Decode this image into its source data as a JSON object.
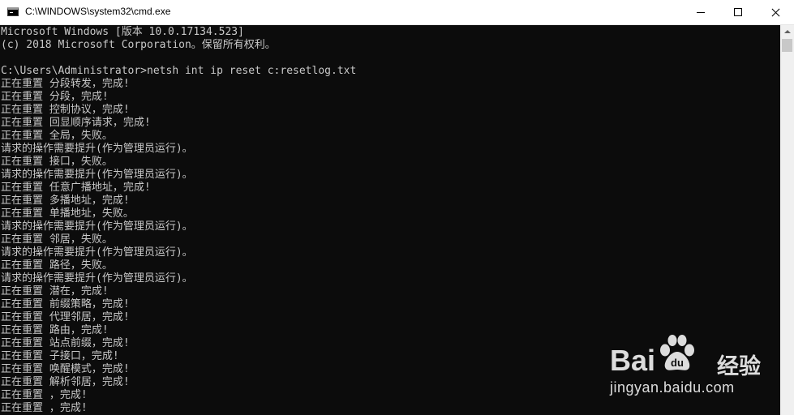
{
  "window": {
    "title": "C:\\WINDOWS\\system32\\cmd.exe"
  },
  "console": {
    "lines": [
      "Microsoft Windows [版本 10.0.17134.523]",
      "(c) 2018 Microsoft Corporation。保留所有权利。",
      "",
      "C:\\Users\\Administrator>netsh int ip reset c:resetlog.txt",
      "正在重置 分段转发，完成!",
      "正在重置 分段，完成!",
      "正在重置 控制协议，完成!",
      "正在重置 回显顺序请求，完成!",
      "正在重置 全局，失败。",
      "请求的操作需要提升(作为管理员运行)。",
      "正在重置 接口，失败。",
      "请求的操作需要提升(作为管理员运行)。",
      "正在重置 任意广播地址，完成!",
      "正在重置 多播地址，完成!",
      "正在重置 单播地址，失败。",
      "请求的操作需要提升(作为管理员运行)。",
      "正在重置 邻居，失败。",
      "请求的操作需要提升(作为管理员运行)。",
      "正在重置 路径，失败。",
      "请求的操作需要提升(作为管理员运行)。",
      "正在重置 潜在，完成!",
      "正在重置 前缀策略，完成!",
      "正在重置 代理邻居，完成!",
      "正在重置 路由，完成!",
      "正在重置 站点前缀，完成!",
      "正在重置 子接口，完成!",
      "正在重置 唤醒模式，完成!",
      "正在重置 解析邻居，完成!",
      "正在重置 ，完成!",
      "正在重置 ，完成!"
    ]
  },
  "watermark": {
    "brand_left": "Bai",
    "brand_right": "du",
    "brand_cn": "经验",
    "url": "jingyan.baidu.com"
  },
  "colors": {
    "console_bg": "#0c0c0c",
    "console_text": "#c8c8c8",
    "titlebar_bg": "#ffffff"
  }
}
